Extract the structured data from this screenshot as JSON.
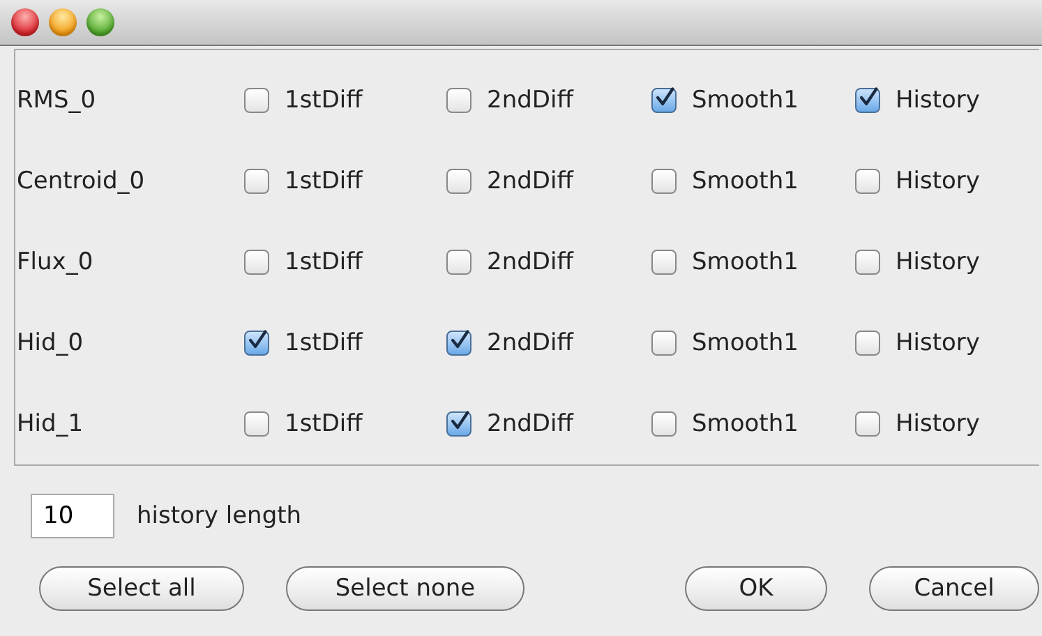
{
  "features": [
    {
      "name": "RMS_0",
      "options": [
        {
          "label": "1stDiff",
          "checked": false
        },
        {
          "label": "2ndDiff",
          "checked": false
        },
        {
          "label": "Smooth1",
          "checked": true
        },
        {
          "label": "History",
          "checked": true
        }
      ]
    },
    {
      "name": "Centroid_0",
      "options": [
        {
          "label": "1stDiff",
          "checked": false
        },
        {
          "label": "2ndDiff",
          "checked": false
        },
        {
          "label": "Smooth1",
          "checked": false
        },
        {
          "label": "History",
          "checked": false
        }
      ]
    },
    {
      "name": "Flux_0",
      "options": [
        {
          "label": "1stDiff",
          "checked": false
        },
        {
          "label": "2ndDiff",
          "checked": false
        },
        {
          "label": "Smooth1",
          "checked": false
        },
        {
          "label": "History",
          "checked": false
        }
      ]
    },
    {
      "name": "Hid_0",
      "options": [
        {
          "label": "1stDiff",
          "checked": true
        },
        {
          "label": "2ndDiff",
          "checked": true
        },
        {
          "label": "Smooth1",
          "checked": false
        },
        {
          "label": "History",
          "checked": false
        }
      ]
    },
    {
      "name": "Hid_1",
      "options": [
        {
          "label": "1stDiff",
          "checked": false
        },
        {
          "label": "2ndDiff",
          "checked": true
        },
        {
          "label": "Smooth1",
          "checked": false
        },
        {
          "label": "History",
          "checked": false
        }
      ]
    }
  ],
  "history": {
    "value": "10",
    "label": "history length"
  },
  "buttons_left": [
    "Select all",
    "Select none"
  ],
  "buttons_right": [
    "OK",
    "Cancel"
  ]
}
